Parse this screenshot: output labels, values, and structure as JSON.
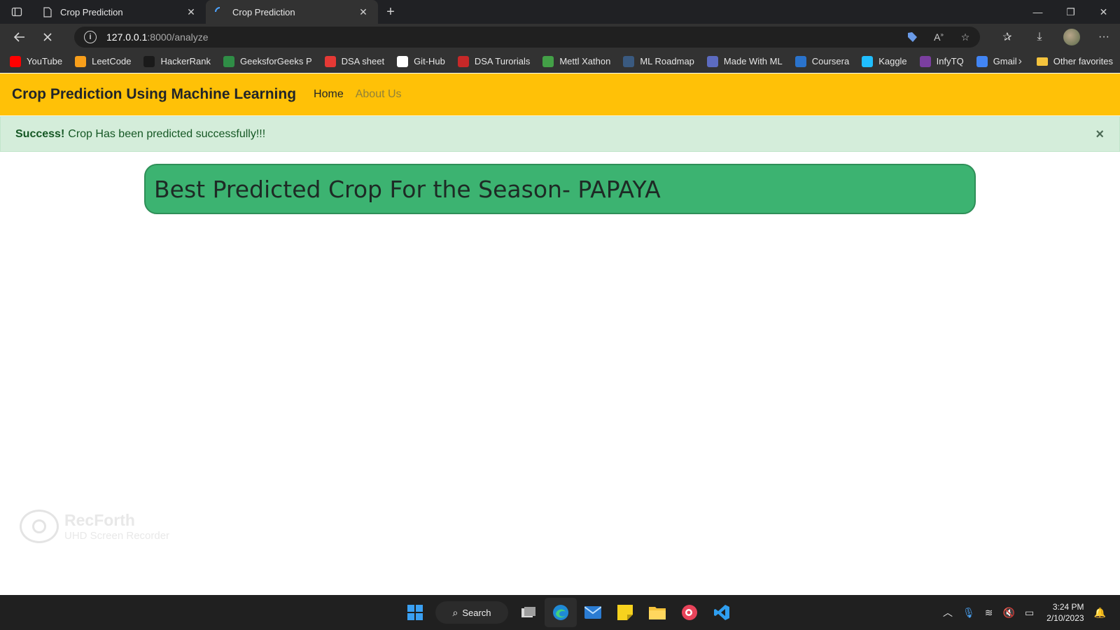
{
  "browser": {
    "tabs": [
      {
        "title": "Crop Prediction",
        "active": false
      },
      {
        "title": "Crop Prediction",
        "active": true
      }
    ],
    "url_host": "127.0.0.1",
    "url_path": ":8000/analyze",
    "bookmarks": [
      {
        "label": "YouTube",
        "icon": "youtube-icon",
        "color": "#ff0000"
      },
      {
        "label": "LeetCode",
        "icon": "leetcode-icon",
        "color": "#f89f1b"
      },
      {
        "label": "HackerRank",
        "icon": "hackerrank-icon",
        "color": "#1a1a1a"
      },
      {
        "label": "GeeksforGeeks P",
        "icon": "geeksforgeeks-icon",
        "color": "#2f8d46"
      },
      {
        "label": "DSA sheet",
        "icon": "dsa-sheet-icon",
        "color": "#e53935"
      },
      {
        "label": "Git-Hub",
        "icon": "github-icon",
        "color": "#ffffff"
      },
      {
        "label": "DSA Turorials",
        "icon": "dsa-tutorials-icon",
        "color": "#c62828"
      },
      {
        "label": "Mettl Xathon",
        "icon": "mettl-icon",
        "color": "#43a047"
      },
      {
        "label": "ML Roadmap",
        "icon": "ml-roadmap-icon",
        "color": "#3a5a80"
      },
      {
        "label": "Made With ML",
        "icon": "made-with-ml-icon",
        "color": "#5c6bc0"
      },
      {
        "label": "Coursera",
        "icon": "coursera-icon",
        "color": "#2a73cc"
      },
      {
        "label": "Kaggle",
        "icon": "kaggle-icon",
        "color": "#20beff"
      },
      {
        "label": "InfyTQ",
        "icon": "infytq-icon",
        "color": "#7b3fa0"
      },
      {
        "label": "Gmail",
        "icon": "google-icon",
        "color": "#4285f4"
      }
    ],
    "other_favorites": "Other favorites"
  },
  "page": {
    "brand": "Crop Prediction Using Machine Learning",
    "nav": {
      "home": "Home",
      "about": "About Us"
    },
    "alert": {
      "strong": "Success!",
      "message": "Crop Has been predicted successfully!!!",
      "close": "×"
    },
    "result": "Best Predicted Crop For the Season- PAPAYA",
    "watermark": {
      "line1": "RecForth",
      "line2": "UHD Screen Recorder"
    }
  },
  "taskbar": {
    "search_label": "Search",
    "time": "3:24 PM",
    "date": "2/10/2023"
  }
}
